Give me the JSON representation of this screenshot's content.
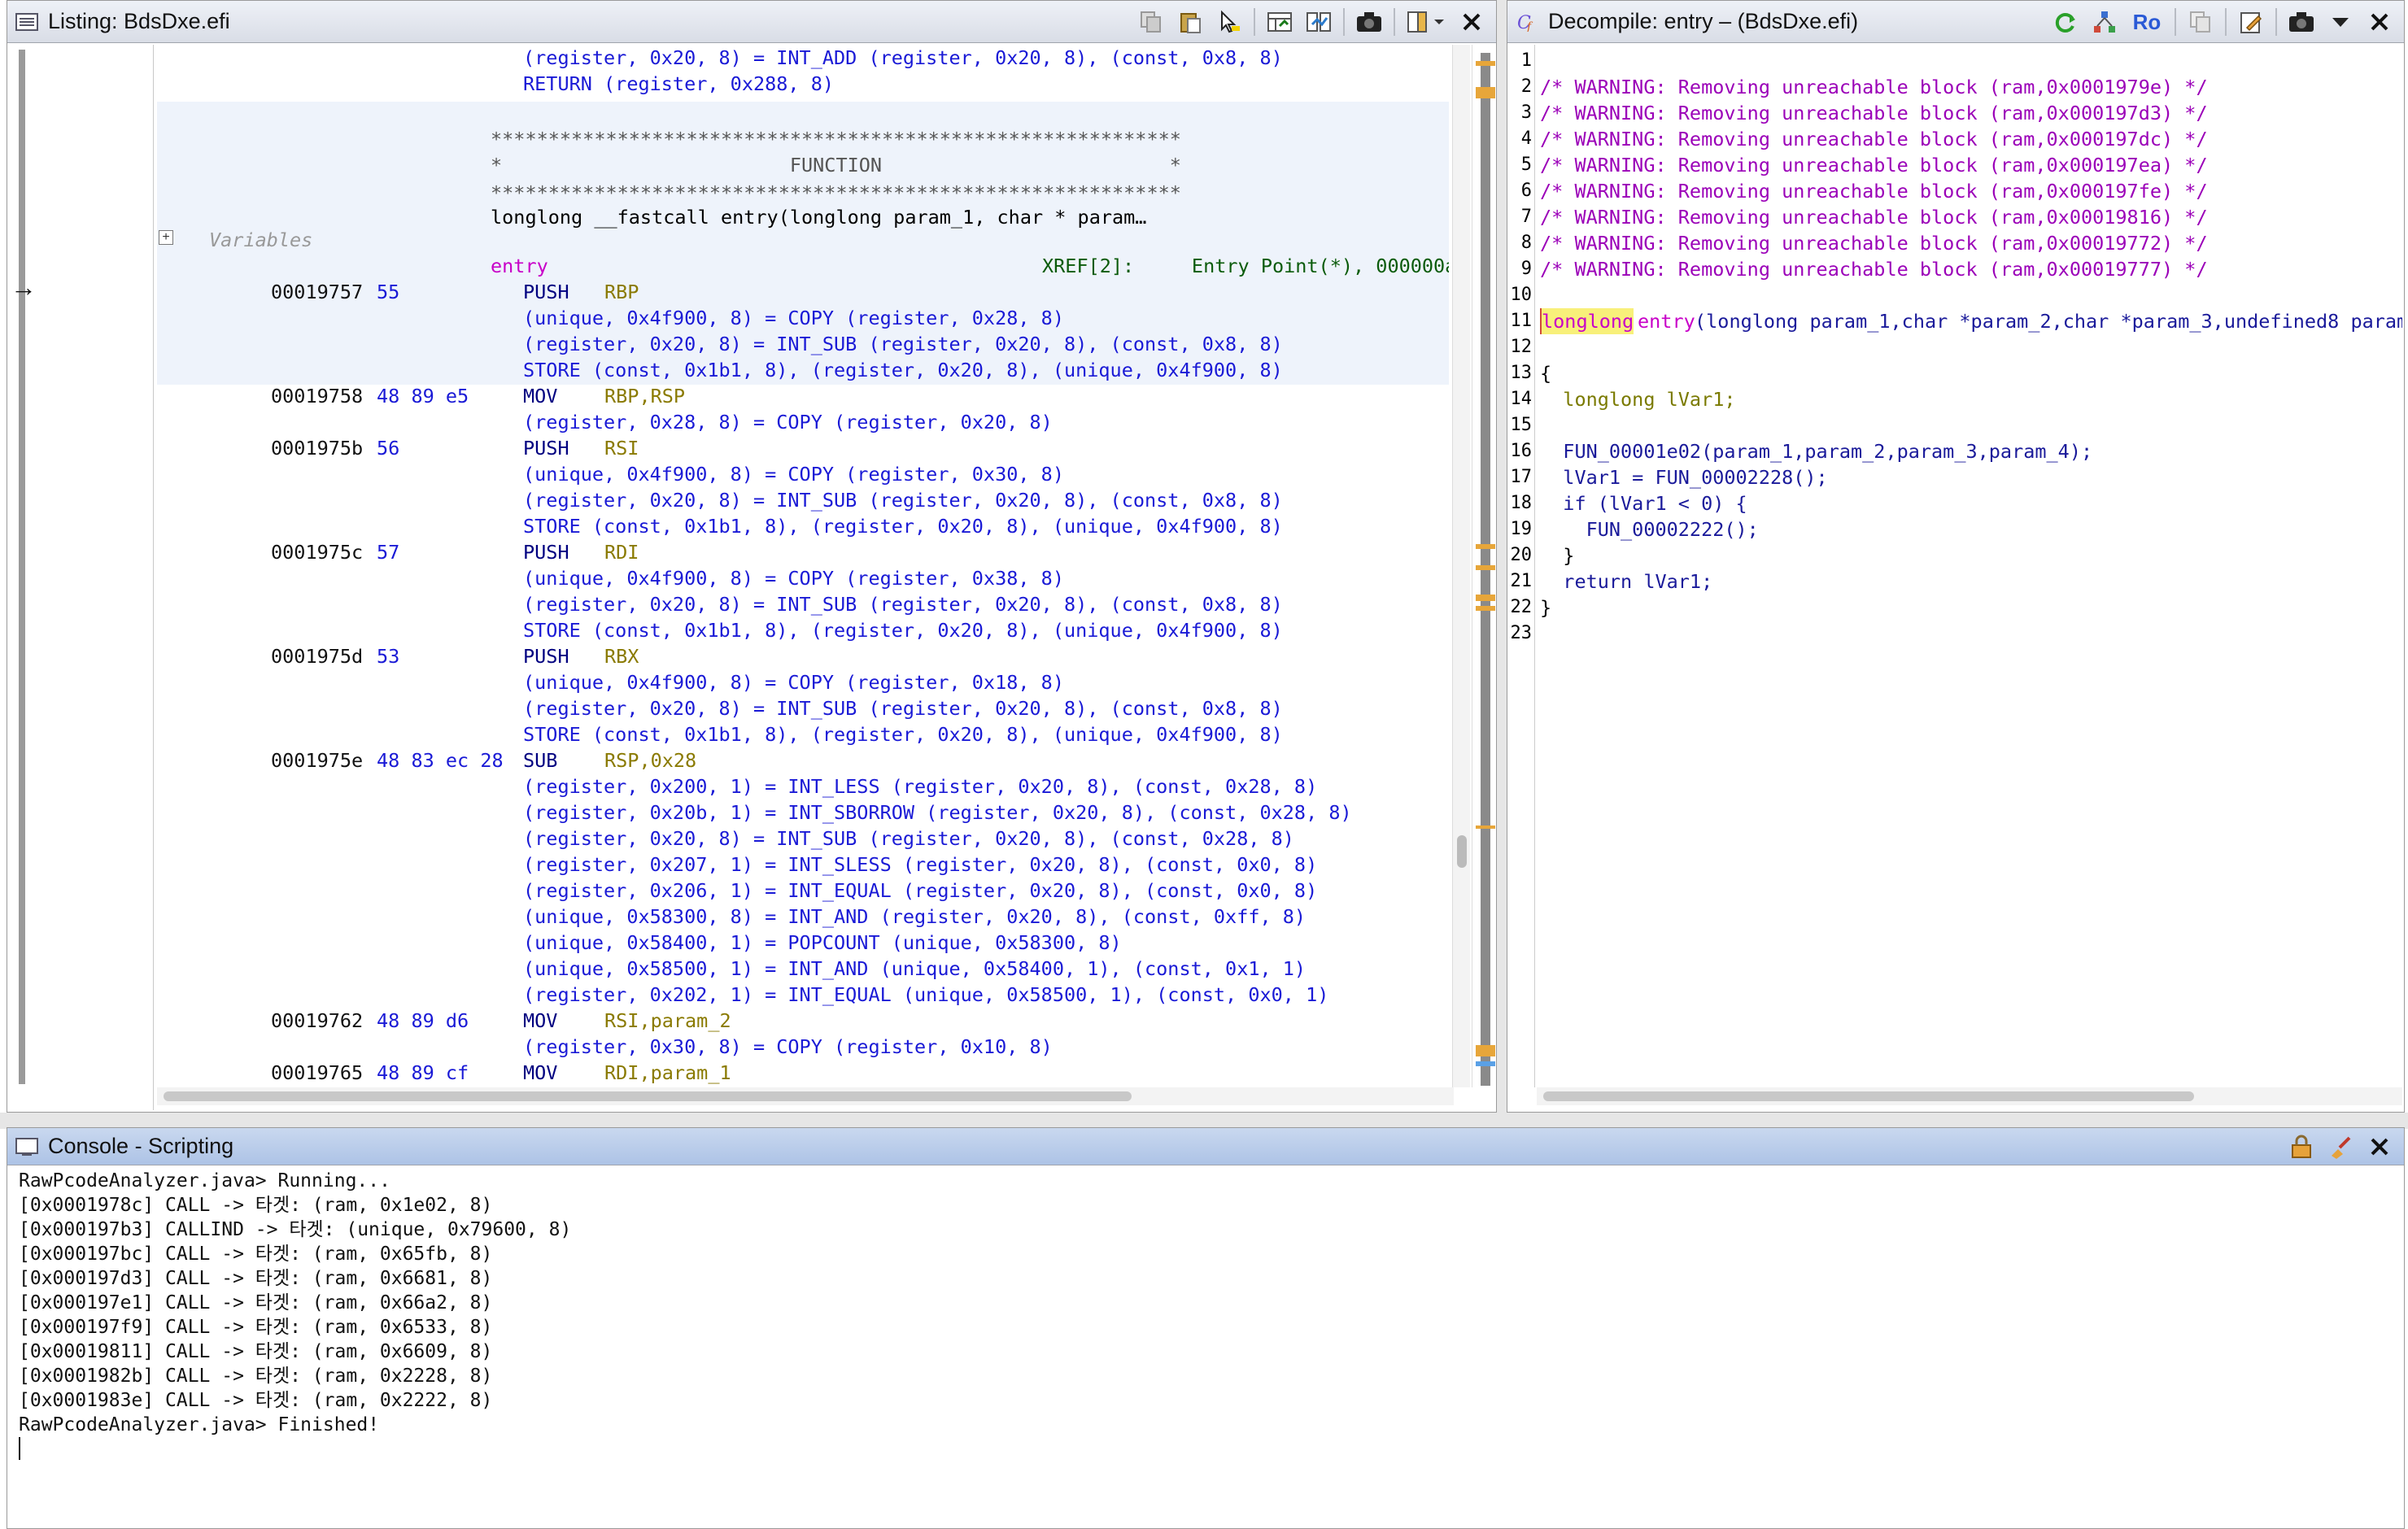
{
  "listing": {
    "title": "Listing:  BdsDxe.efi",
    "lines_top": [
      "(register, 0x20, 8) = INT_ADD (register, 0x20, 8), (const, 0x8, 8)",
      "RETURN (register, 0x288, 8)"
    ],
    "banner_stars": "************************************************************",
    "banner_function": "*                         FUNCTION                         *",
    "signature": "longlong __fastcall entry(longlong param_1, char * param…",
    "variables_label": "Variables",
    "entry_label": "entry",
    "xref": "XREF[2]:     Entry Point(*), 000000a",
    "instructions": [
      {
        "addr": "00019757",
        "bytes": "55",
        "mnem": "PUSH",
        "ops": "RBP",
        "pcode": [
          "(unique, 0x4f900, 8) = COPY (register, 0x28, 8)",
          "(register, 0x20, 8) = INT_SUB (register, 0x20, 8), (const, 0x8, 8)",
          "STORE (const, 0x1b1, 8), (register, 0x20, 8), (unique, 0x4f900, 8)"
        ]
      },
      {
        "addr": "00019758",
        "bytes": "48 89 e5",
        "mnem": "MOV",
        "ops": "RBP,RSP",
        "pcode": [
          "(register, 0x28, 8) = COPY (register, 0x20, 8)"
        ]
      },
      {
        "addr": "0001975b",
        "bytes": "56",
        "mnem": "PUSH",
        "ops": "RSI",
        "pcode": [
          "(unique, 0x4f900, 8) = COPY (register, 0x30, 8)",
          "(register, 0x20, 8) = INT_SUB (register, 0x20, 8), (const, 0x8, 8)",
          "STORE (const, 0x1b1, 8), (register, 0x20, 8), (unique, 0x4f900, 8)"
        ]
      },
      {
        "addr": "0001975c",
        "bytes": "57",
        "mnem": "PUSH",
        "ops": "RDI",
        "pcode": [
          "(unique, 0x4f900, 8) = COPY (register, 0x38, 8)",
          "(register, 0x20, 8) = INT_SUB (register, 0x20, 8), (const, 0x8, 8)",
          "STORE (const, 0x1b1, 8), (register, 0x20, 8), (unique, 0x4f900, 8)"
        ]
      },
      {
        "addr": "0001975d",
        "bytes": "53",
        "mnem": "PUSH",
        "ops": "RBX",
        "pcode": [
          "(unique, 0x4f900, 8) = COPY (register, 0x18, 8)",
          "(register, 0x20, 8) = INT_SUB (register, 0x20, 8), (const, 0x8, 8)",
          "STORE (const, 0x1b1, 8), (register, 0x20, 8), (unique, 0x4f900, 8)"
        ]
      },
      {
        "addr": "0001975e",
        "bytes": "48 83 ec 28",
        "mnem": "SUB",
        "ops": "RSP,0x28",
        "pcode": [
          "(register, 0x200, 1) = INT_LESS (register, 0x20, 8), (const, 0x28, 8)",
          "(register, 0x20b, 1) = INT_SBORROW (register, 0x20, 8), (const, 0x28, 8)",
          "(register, 0x20, 8) = INT_SUB (register, 0x20, 8), (const, 0x28, 8)",
          "(register, 0x207, 1) = INT_SLESS (register, 0x20, 8), (const, 0x0, 8)",
          "(register, 0x206, 1) = INT_EQUAL (register, 0x20, 8), (const, 0x0, 8)",
          "(unique, 0x58300, 8) = INT_AND (register, 0x20, 8), (const, 0xff, 8)",
          "(unique, 0x58400, 1) = POPCOUNT (unique, 0x58300, 8)",
          "(unique, 0x58500, 1) = INT_AND (unique, 0x58400, 1), (const, 0x1, 1)",
          "(register, 0x202, 1) = INT_EQUAL (unique, 0x58500, 1), (const, 0x0, 1)"
        ]
      },
      {
        "addr": "00019762",
        "bytes": "48 89 d6",
        "mnem": "MOV",
        "ops": "RSI,param_2",
        "pcode": [
          "(register, 0x30, 8) = COPY (register, 0x10, 8)"
        ]
      },
      {
        "addr": "00019765",
        "bytes": "48 89 cf",
        "mnem": "MOV",
        "ops": "RDI,param_1",
        "pcode": []
      }
    ]
  },
  "decompile": {
    "title": "Decompile: entry –  (BdsDxe.efi)",
    "ro_label": "Ro",
    "line_numbers": [
      "1",
      "2",
      "3",
      "4",
      "5",
      "6",
      "7",
      "8",
      "9",
      "10",
      "11",
      "12",
      "13",
      "14",
      "15",
      "16",
      "17",
      "18",
      "19",
      "20",
      "21",
      "22",
      "23"
    ],
    "warnings": [
      "/* WARNING: Removing unreachable block (ram,0x0001979e) */",
      "/* WARNING: Removing unreachable block (ram,0x000197d3) */",
      "/* WARNING: Removing unreachable block (ram,0x000197dc) */",
      "/* WARNING: Removing unreachable block (ram,0x000197ea) */",
      "/* WARNING: Removing unreachable block (ram,0x000197fe) */",
      "/* WARNING: Removing unreachable block (ram,0x00019816) */",
      "/* WARNING: Removing unreachable block (ram,0x00019772) */",
      "/* WARNING: Removing unreachable block (ram,0x00019777) */"
    ],
    "sig_type": "longlong",
    "sig_name": "entry",
    "sig_rest": "(longlong param_1,char *param_2,char *param_3,undefined8 param_",
    "brace_open": "{",
    "decl": "  longlong lVar1;",
    "call1": "  FUN_00001e02(param_1,param_2,param_3,param_4);",
    "assign": "  lVar1 = FUN_00002228();",
    "if_line": "  if (lVar1 < 0) {",
    "call2": "    FUN_00002222();",
    "close_if": "  }",
    "ret": "  return lVar1;",
    "brace_close": "}"
  },
  "console": {
    "title": "Console - Scripting",
    "lines": [
      "RawPcodeAnalyzer.java> Running...",
      "[0x0001978c] CALL -> 타겟: (ram, 0x1e02, 8)",
      "[0x000197b3] CALLIND -> 타겟: (unique, 0x79600, 8)",
      "[0x000197bc] CALL -> 타겟: (ram, 0x65fb, 8)",
      "[0x000197d3] CALL -> 타겟: (ram, 0x6681, 8)",
      "[0x000197e1] CALL -> 타겟: (ram, 0x66a2, 8)",
      "[0x000197f9] CALL -> 타겟: (ram, 0x6533, 8)",
      "[0x00019811] CALL -> 타겟: (ram, 0x6609, 8)",
      "[0x0001982b] CALL -> 타겟: (ram, 0x2228, 8)",
      "[0x0001983e] CALL -> 타겟: (ram, 0x2222, 8)",
      "RawPcodeAnalyzer.java> Finished!"
    ]
  }
}
